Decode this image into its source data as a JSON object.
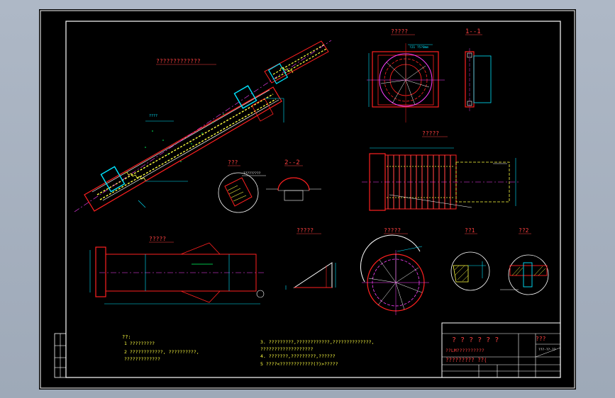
{
  "drawing": {
    "views": {
      "main_title": "?????????????",
      "top_right_title": "?????",
      "section_1_1": "1--1",
      "right_mid_title": "?????",
      "detail_a": "???",
      "section_2_2": "2--2",
      "bottom_left_title": "?????",
      "bottom_mid_title": "?????",
      "bottom_disc_title": "?????",
      "detail_i": "??1",
      "detail_ii": "??2"
    },
    "callouts": {
      "main_left_note": "????",
      "top_right_note": "?21 ?5?0mm",
      "detail_a_note": "?????????"
    },
    "notes": {
      "heading": "??:",
      "items": [
        "1  ?????????",
        "2  ????????????, ??????????,",
        "   ?????????????",
        "3. ?????????,????????????,??????????????,",
        "   ???????????????????",
        "4. ???????,?????????,??????",
        "5  ????<????????????(?)>?????"
      ]
    },
    "title_block": {
      "title": "? ? ? ? ? ?",
      "drawing_no": "??LM??????????",
      "label_right": "???",
      "material": "????????? ??(",
      "code": "???-??-??"
    },
    "colors": {
      "background": "#000000",
      "frame": "#ffffff",
      "outline": "#ff2020",
      "dimension": "#00e5ff",
      "text_title": "#ff4040",
      "hatch": "#ffff40",
      "centerline": "#ff40ff",
      "notes": "#ffff40"
    }
  }
}
